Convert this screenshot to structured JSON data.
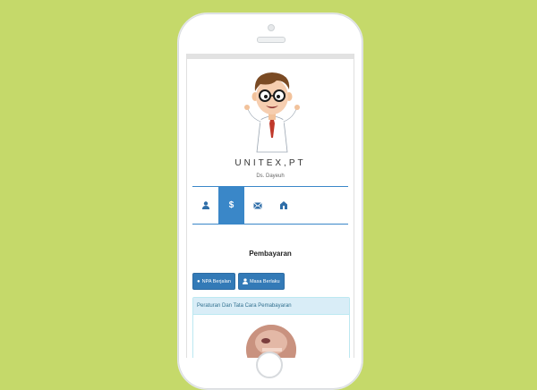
{
  "company": {
    "name": "UNITEX,PT",
    "subtitle": "Ds. Dayeuh"
  },
  "tabs": [
    {
      "icon": "user-icon",
      "active": false
    },
    {
      "icon": "dollar-icon",
      "label": "$",
      "active": true
    },
    {
      "icon": "envelope-icon",
      "active": false
    },
    {
      "icon": "home-icon",
      "active": false
    }
  ],
  "section": {
    "title": "Pembayaran"
  },
  "buttons": {
    "npa": {
      "label": "NPA Berjalan",
      "icon": "tint-icon"
    },
    "masa": {
      "label": "Masa Berlaku",
      "icon": "user-icon"
    }
  },
  "panel": {
    "heading": "Peraturan Dan Tata Cara Pemabayaran"
  },
  "colors": {
    "background": "#c5d96a",
    "accent": "#3a87c8",
    "panel": "#d9edf7"
  }
}
